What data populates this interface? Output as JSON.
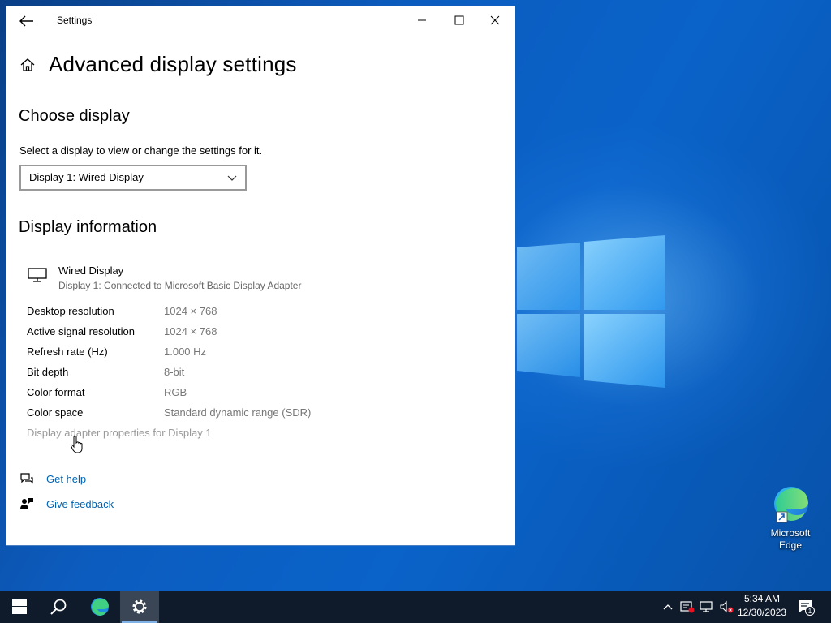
{
  "window": {
    "title": "Settings"
  },
  "page": {
    "title": "Advanced display settings"
  },
  "choose": {
    "heading": "Choose display",
    "description": "Select a display to view or change the settings for it.",
    "selected": "Display 1: Wired Display"
  },
  "info": {
    "heading": "Display information",
    "display_name": "Wired Display",
    "display_sub": "Display 1: Connected to Microsoft Basic Display Adapter",
    "rows": [
      {
        "label": "Desktop resolution",
        "value": "1024 × 768"
      },
      {
        "label": "Active signal resolution",
        "value": "1024 × 768"
      },
      {
        "label": "Refresh rate (Hz)",
        "value": "1.000 Hz"
      },
      {
        "label": "Bit depth",
        "value": "8-bit"
      },
      {
        "label": "Color format",
        "value": "RGB"
      },
      {
        "label": "Color space",
        "value": "Standard dynamic range (SDR)"
      }
    ],
    "adapter_link": "Display adapter properties for Display 1"
  },
  "help": {
    "get_help": "Get help",
    "give_feedback": "Give feedback"
  },
  "desktop": {
    "edge_label_1": "Microsoft",
    "edge_label_2": "Edge"
  },
  "taskbar": {
    "time": "5:34 AM",
    "date": "12/30/2023",
    "notification_count": "1"
  },
  "icons": [
    "back-arrow-icon",
    "minimize-icon",
    "maximize-icon",
    "close-icon",
    "home-icon",
    "chevron-down-icon",
    "monitor-icon",
    "help-icon",
    "feedback-icon",
    "windows-start-icon",
    "search-icon",
    "edge-icon",
    "gear-icon",
    "chevron-up-icon",
    "network-icon",
    "volume-mute-icon",
    "notification-icon"
  ],
  "colors": {
    "accent_link": "#0063b1",
    "taskbar": "#0f1a2b",
    "desktop": "#0a5cbf"
  }
}
